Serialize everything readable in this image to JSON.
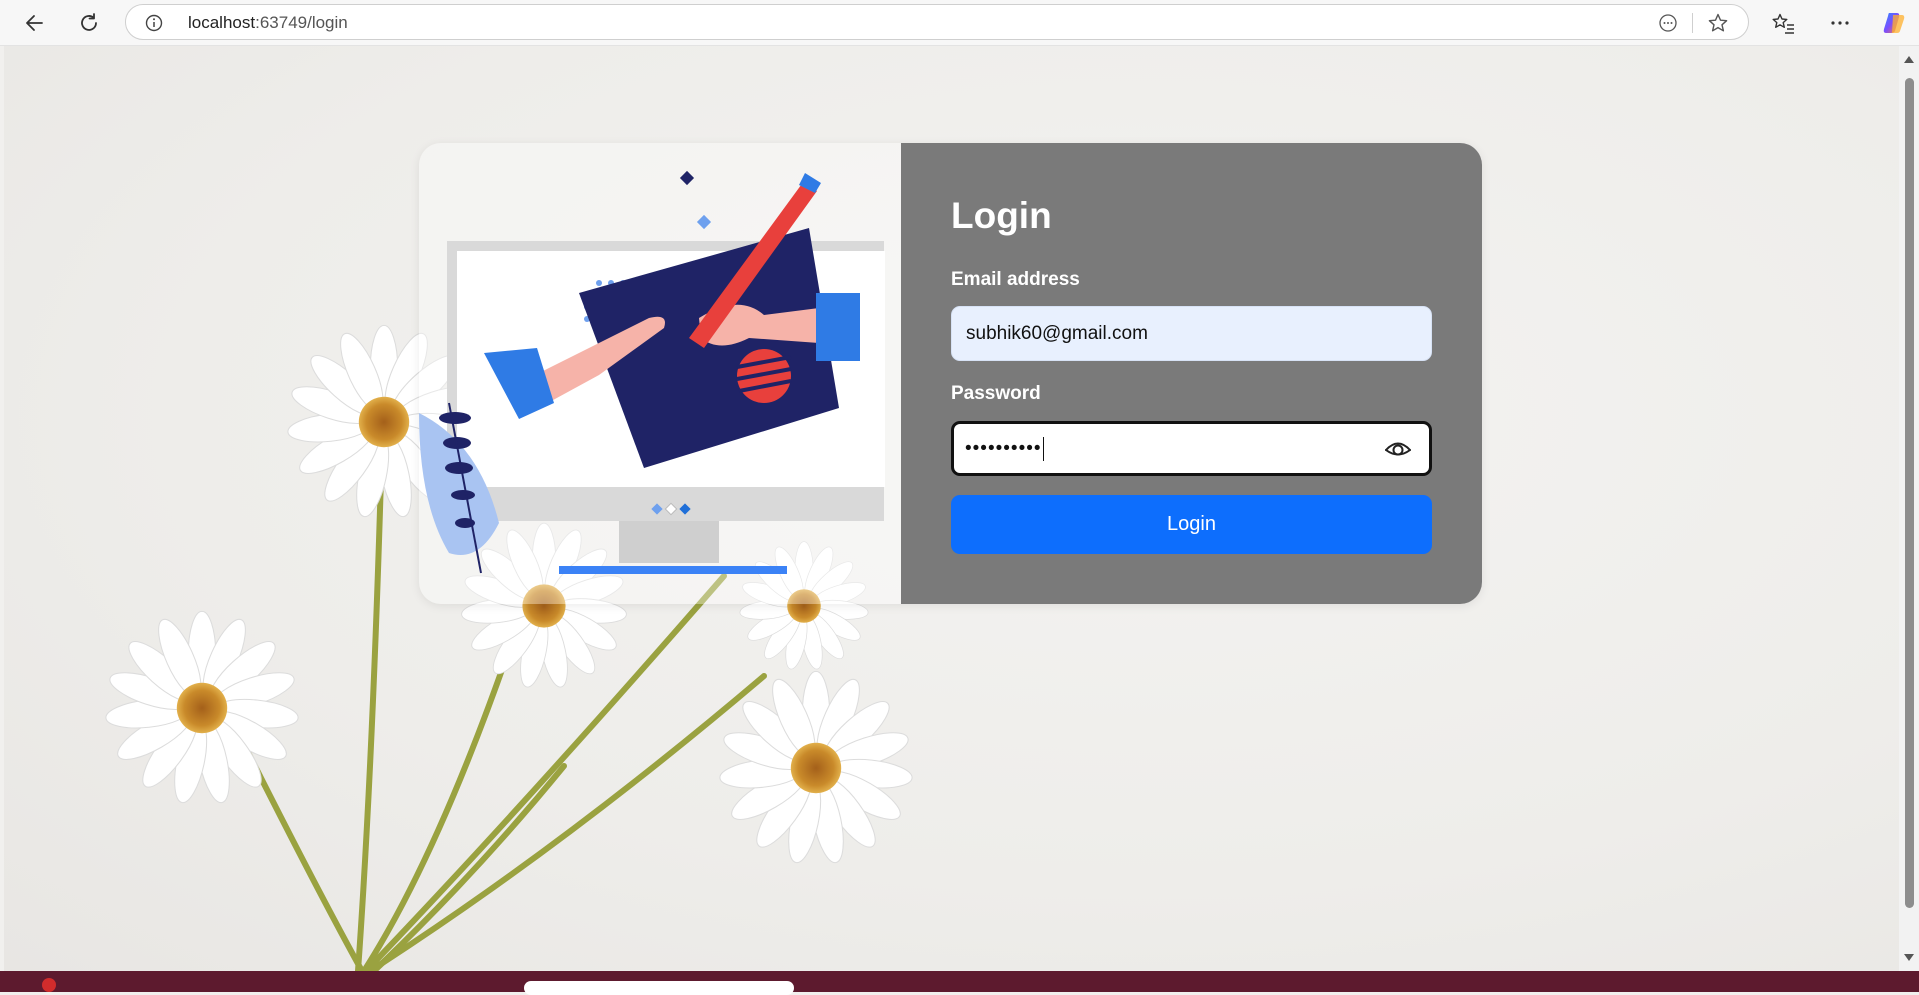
{
  "browser": {
    "url_host": "localhost",
    "url_path": ":63749/login"
  },
  "login": {
    "title": "Login",
    "email_label": "Email address",
    "email_value": "subhik60@gmail.com",
    "password_label": "Password",
    "password_masked": "••••••••••",
    "button_label": "Login"
  },
  "colors": {
    "form_panel": "#7a7a7a",
    "primary_button": "#0d6efd",
    "email_autofill_bg": "#e8f0fe"
  }
}
